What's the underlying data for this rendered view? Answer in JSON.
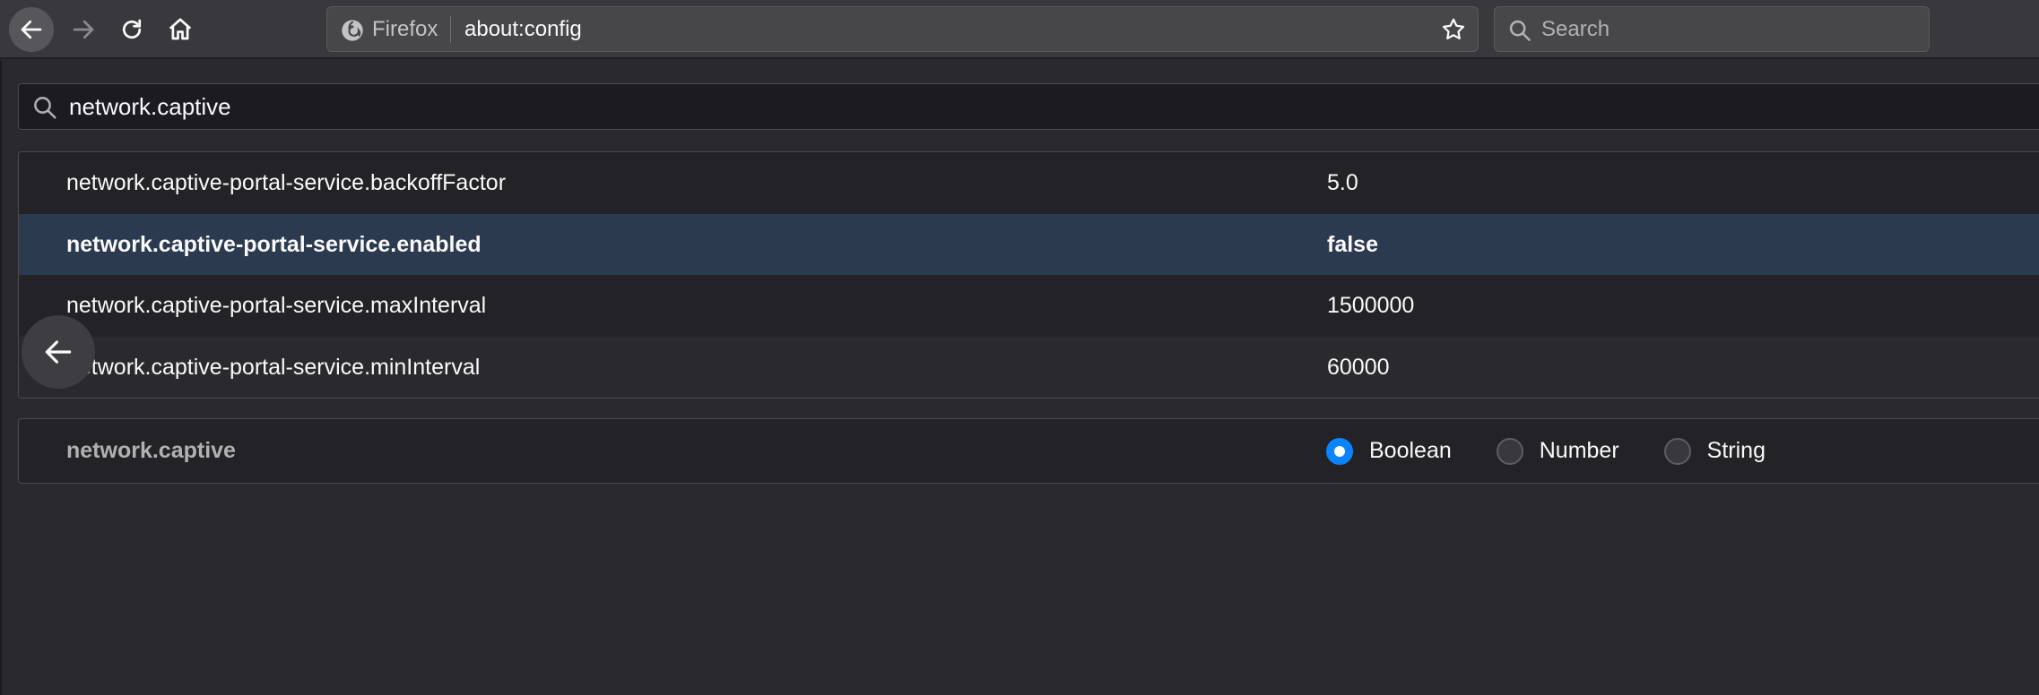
{
  "toolbar": {
    "identity_label": "Firefox",
    "url": "about:config",
    "search_placeholder": "Search"
  },
  "filter": {
    "value": "network.captive"
  },
  "prefs": [
    {
      "name": "network.captive-portal-service.backoffFactor",
      "value": "5.0",
      "modified": false
    },
    {
      "name": "network.captive-portal-service.enabled",
      "value": "false",
      "modified": true
    },
    {
      "name": "network.captive-portal-service.maxInterval",
      "value": "1500000",
      "modified": false
    },
    {
      "name": "network.captive-portal-service.minInterval",
      "value": "60000",
      "modified": false
    }
  ],
  "new_pref": {
    "name": "network.captive",
    "types": [
      "Boolean",
      "Number",
      "String"
    ],
    "selected": "Boolean"
  },
  "colors": {
    "accent": "#0a84ff",
    "modified_row": "#2c3a50"
  }
}
